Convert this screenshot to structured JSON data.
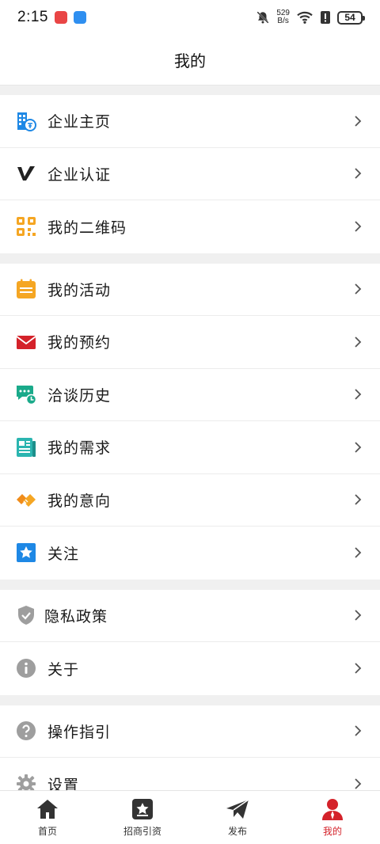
{
  "status": {
    "time": "2:15",
    "net_speed_value": "529",
    "net_speed_unit": "B/s",
    "battery": "54"
  },
  "header": {
    "title": "我的"
  },
  "groups": [
    {
      "items": [
        {
          "label": "企业主页",
          "icon": "building-icon"
        },
        {
          "label": "企业认证",
          "icon": "verified-v-icon"
        },
        {
          "label": "我的二维码",
          "icon": "qrcode-icon"
        }
      ]
    },
    {
      "items": [
        {
          "label": "我的活动",
          "icon": "calendar-icon"
        },
        {
          "label": "我的预约",
          "icon": "envelope-icon"
        },
        {
          "label": "洽谈历史",
          "icon": "chat-clock-icon"
        },
        {
          "label": "我的需求",
          "icon": "document-icon"
        },
        {
          "label": "我的意向",
          "icon": "handshake-icon"
        },
        {
          "label": "关注",
          "icon": "star-icon"
        }
      ]
    },
    {
      "items": [
        {
          "label": "隐私政策",
          "icon": "shield-check-icon"
        },
        {
          "label": "关于",
          "icon": "info-icon"
        }
      ]
    },
    {
      "items": [
        {
          "label": "操作指引",
          "icon": "help-icon"
        },
        {
          "label": "设置",
          "icon": "gear-icon"
        }
      ]
    }
  ],
  "tabbar": {
    "tabs": [
      {
        "label": "首页",
        "icon": "home-icon"
      },
      {
        "label": "招商引资",
        "icon": "star-badge-icon"
      },
      {
        "label": "发布",
        "icon": "paper-plane-icon"
      },
      {
        "label": "我的",
        "icon": "user-icon",
        "active": true
      }
    ]
  },
  "colors": {
    "accent_red": "#d4222a",
    "blue": "#1e88e5",
    "orange": "#f5a623",
    "green": "#1aaa8a",
    "teal": "#2bb5b0",
    "gray_icon": "#9e9e9e"
  }
}
